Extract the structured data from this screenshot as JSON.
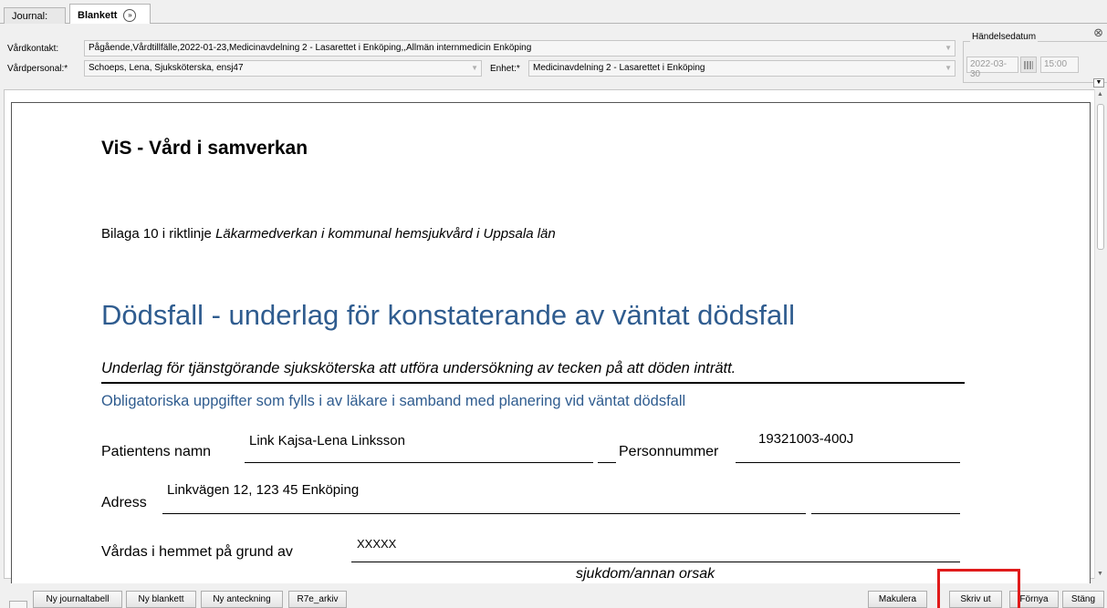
{
  "tabs": [
    {
      "label": "Journal:"
    },
    {
      "label": "Blankett",
      "icon": "double-chevron-icon"
    }
  ],
  "form": {
    "vardkontakt_label": "Vårdkontakt:",
    "vardkontakt_value": "Pågående,Vårdtillfälle,2022-01-23,Medicinavdelning 2 - Lasarettet i Enköping,,Allmän internmedicin Enköping",
    "vardpersonal_label": "Vårdpersonal:*",
    "vardpersonal_value": "Schoeps, Lena, Sjuksköterska, ensj47",
    "enhet_label": "Enhet:*",
    "enhet_value": "Medicinavdelning 2 - Lasarettet i Enköping",
    "handelsedatum_label": "Händelsedatum",
    "date_value": "2022-03-30",
    "time_value": "15:00"
  },
  "document": {
    "title": "ViS - Vård i samverkan",
    "bilaga_prefix": "Bilaga 10 i riktlinje ",
    "bilaga_italic": "Läkarmedverkan i kommunal hemsjukvård i Uppsala län",
    "heading": "Dödsfall - underlag för konstaterande av väntat dödsfall",
    "underlag": "Underlag för tjänstgörande sjuksköterska att utföra undersökning av tecken på att döden inträtt.",
    "obligatoriska": "Obligatoriska uppgifter som fylls i av läkare i samband med planering vid väntat dödsfall",
    "patient_label": "Patientens namn",
    "patient_value": "Link Kajsa-Lena Linksson",
    "personnummer_label": "Personnummer",
    "personnummer_value": "19321003-400J",
    "adress_label": "Adress",
    "adress_value": "Linkvägen 12, 123 45 Enköping",
    "vardas_label": "Vårdas i hemmet på grund av",
    "vardas_value": "XXXXX",
    "sjukdom_label": "sjukdom/annan orsak"
  },
  "buttons": {
    "ny_journaltabell": "Ny journaltabell",
    "ny_blankett": "Ny blankett",
    "ny_anteckning": "Ny anteckning",
    "r7e_arkiv": "R7e_arkiv",
    "makulera": "Makulera",
    "skriv_ut": "Skriv ut",
    "fornya": "Förnya",
    "stang": "Stäng"
  },
  "colors": {
    "heading_blue": "#2f5c8f",
    "highlight_red": "#e01b1b"
  }
}
